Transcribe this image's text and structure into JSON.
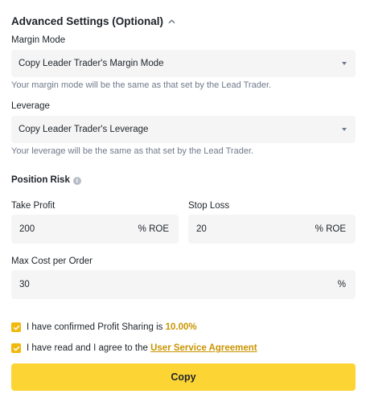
{
  "advanced": {
    "title": "Advanced Settings (Optional)"
  },
  "margin_mode": {
    "label": "Margin Mode",
    "value": "Copy Leader Trader's Margin Mode",
    "helper": "Your margin mode will be the same as that set by the Lead Trader."
  },
  "leverage": {
    "label": "Leverage",
    "value": "Copy Leader Trader's Leverage",
    "helper": "Your leverage will be the same as that set by the Lead Trader."
  },
  "position_risk": {
    "label": "Position Risk",
    "info_icon": "info-icon",
    "take_profit": {
      "label": "Take Profit",
      "value": "200",
      "unit": "% ROE"
    },
    "stop_loss": {
      "label": "Stop Loss",
      "value": "20",
      "unit": "% ROE"
    }
  },
  "max_cost": {
    "label": "Max Cost per Order",
    "value": "30",
    "unit": "%"
  },
  "confirmations": {
    "profit_sharing_prefix": "I have confirmed Profit Sharing is ",
    "profit_sharing_value": "10.00%",
    "profit_sharing_checked": true,
    "agreement_prefix": "I have read and I agree to the ",
    "agreement_link": "User Service Agreement",
    "agreement_checked": true
  },
  "copy_button": "Copy",
  "colors": {
    "accent": "#f0b90b",
    "button": "#fcd535",
    "link": "#c99400",
    "field_bg": "#f5f5f5",
    "muted_text": "#707a8a"
  }
}
